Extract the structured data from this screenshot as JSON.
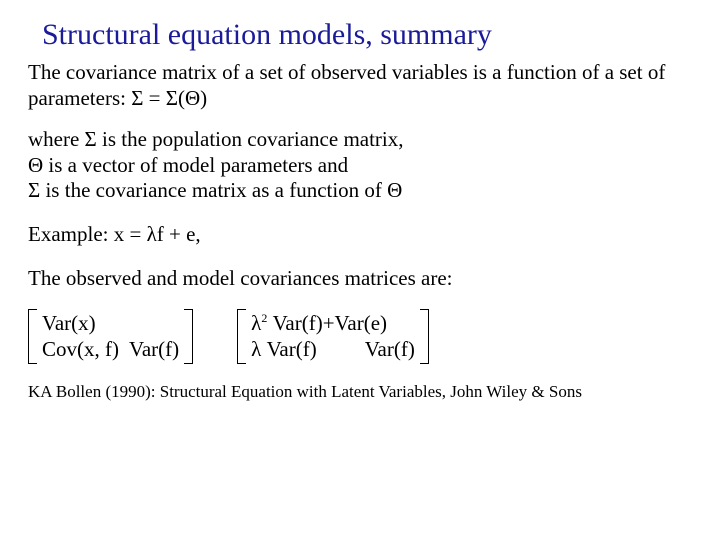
{
  "title": "Structural equation models, summary",
  "p1": "The covariance matrix of a set of observed variables is a function of a set of parameters: Σ = Σ(Θ)",
  "p2a": "where Σ is the population covariance matrix,",
  "p2b": "Θ is a vector of model parameters and",
  "p2c": "Σ is the covariance matrix as a function of Θ",
  "p3": "Example: x = λf + e,",
  "p4": "The observed and model covariances matrices are:",
  "m1r1": "Var(x)",
  "m1r2a": "Cov(x, f)",
  "m1r2b": "Var(f)",
  "m2r1_lambda": "λ",
  "m2r1_sup": "2",
  "m2r1_rest": " Var(f)+Var(e)",
  "m2r2a": "λ Var(f)",
  "m2r2b": "Var(f)",
  "reference": "KA Bollen (1990): Structural Equation with Latent Variables, John Wiley & Sons"
}
